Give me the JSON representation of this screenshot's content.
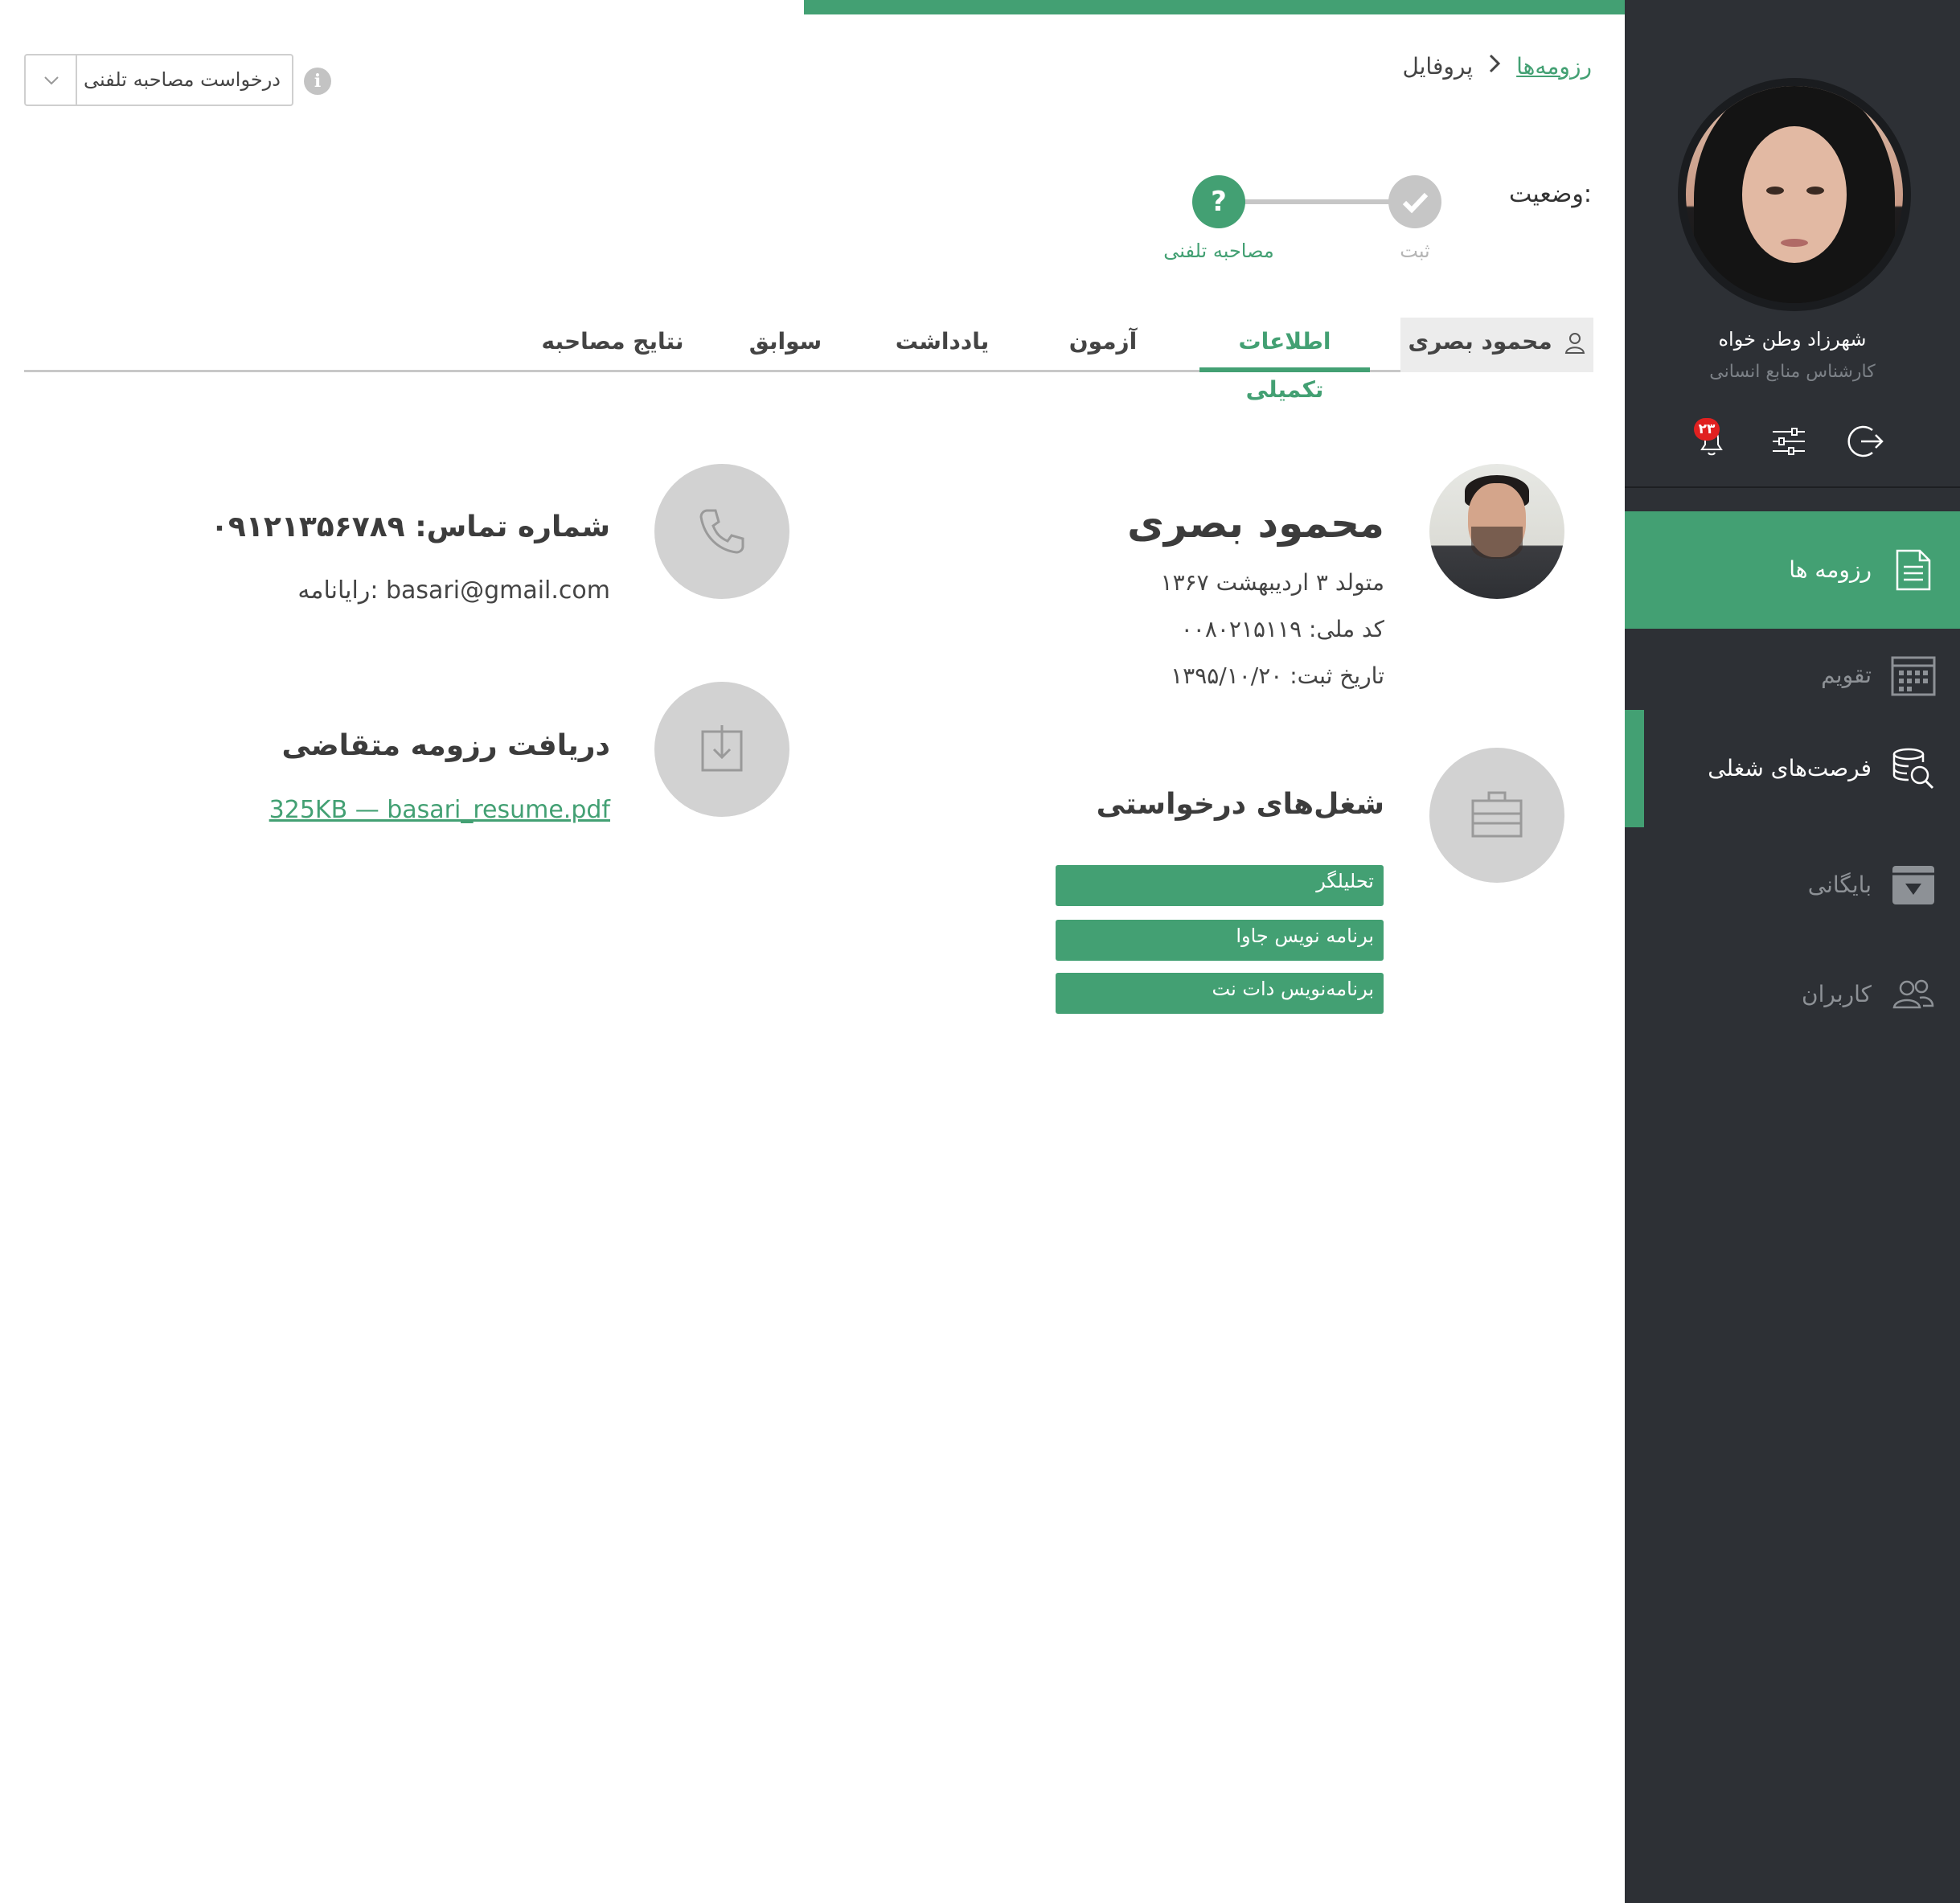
{
  "breadcrumb": {
    "root": "رزومه‌ها",
    "separator": "›",
    "current": "پروفایل"
  },
  "request": {
    "selected": "درخواست مصاحبه تلفنی",
    "info_icon": "i"
  },
  "status": {
    "label": "وضعیت:",
    "steps": [
      {
        "label": "ثبت",
        "state": "done",
        "icon": "check-icon"
      },
      {
        "label": "مصاحبه تلفنی",
        "state": "current",
        "icon": "?"
      }
    ]
  },
  "tabs": [
    "محمود بصری",
    "اطلاعات تکمیلی",
    "آزمون",
    "یادداشت",
    "سوابق",
    "نتایج مصاحبه"
  ],
  "active_tab": "اطلاعات تکمیلی",
  "candidate": {
    "name": "محمود بصری",
    "birth": "متولد ۳ اردیبهشت ۱۳۶۷",
    "national_id": "کد ملی: ۰۰۸۰۲۱۵۱۱۹",
    "reg_date": "تاریخ ثبت: ۱۳۹۵/۱۰/۲۰"
  },
  "contact": {
    "phone": "شماره تماس: ۰۹۱۲۱۳۵۶۷۸۹",
    "email": "رایانامه: basari@gmail.com"
  },
  "resume": {
    "title": "دریافت رزومه متقاضی",
    "file": "325KB — basari_resume.pdf"
  },
  "jobs": {
    "title": "شغل‌های درخواستی",
    "items": [
      "تحلیلگر",
      "برنامه نویس جاوا",
      "برنامه‌نویس دات نت"
    ]
  },
  "sidebar": {
    "user_name": "شهرزاد  وطن خواه",
    "user_role": "کارشناس منابع انسانی",
    "notifications": "۲۳",
    "nav": [
      {
        "label": "رزومه ها",
        "icon": "document-icon",
        "state": "active"
      },
      {
        "label": "تقویم",
        "icon": "calendar-icon",
        "state": "normal"
      },
      {
        "label": "فرصت‌های شغلی",
        "icon": "job-search-icon",
        "state": "highlight"
      },
      {
        "label": "بایگانی",
        "icon": "archive-icon",
        "state": "normal"
      },
      {
        "label": "کاربران",
        "icon": "users-icon",
        "state": "normal"
      }
    ]
  },
  "colors": {
    "accent": "#43a073",
    "sidebar_bg": "#2d3035",
    "badge": "#e02020",
    "muted": "#d2d2d2"
  }
}
